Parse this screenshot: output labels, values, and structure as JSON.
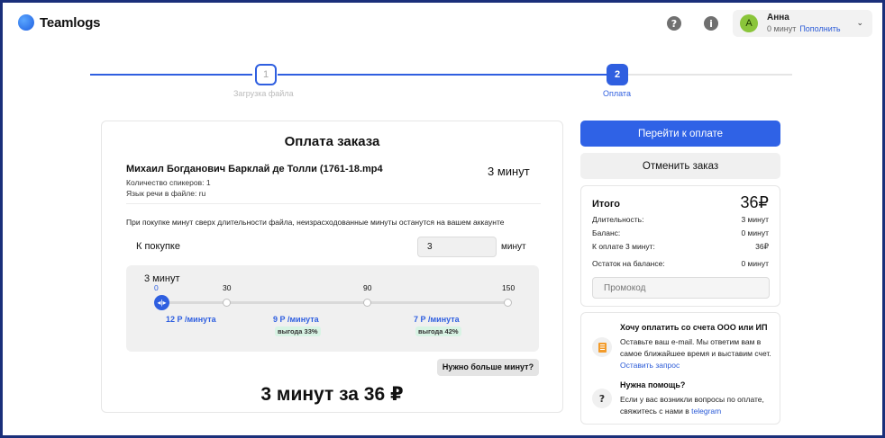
{
  "header": {
    "logo_text": "Teamlogs",
    "help_glyph": "?",
    "info_glyph": "i",
    "account": {
      "avatar_letter": "А",
      "name": "Анна",
      "balance": "0 минут",
      "topup_label": "Пополнить",
      "chevron": "⌄"
    }
  },
  "stepper": {
    "steps": [
      {
        "number": "1",
        "label": "Загрузка файла",
        "state": "done"
      },
      {
        "number": "2",
        "label": "Оплата",
        "state": "active"
      }
    ]
  },
  "order": {
    "title": "Оплата заказа",
    "file_name": "Михаил Богданович Барклай де Толли (1761-18.mp4",
    "file_duration": "3 минут",
    "speakers": "Количество спикеров: 1",
    "language": "Язык речи в файле: ru",
    "notice": "При покупке минут сверх длительности файла, неизрасходованные минуты останутся на вашем аккаунте",
    "buy_label": "К покупке",
    "buy_value": "3",
    "buy_unit": "минут",
    "slider": {
      "current_label": "3 минут",
      "ticks": [
        "0",
        "30",
        "90",
        "150"
      ],
      "thumb_glyph": "◂|▸",
      "prices": [
        "12 Р /минута",
        "9 Р /минута",
        "7 Р /минута"
      ],
      "badges": [
        "выгода 33%",
        "выгода 42%"
      ]
    },
    "more_minutes_label": "Нужно больше минут?",
    "total_text": "3 минут за 36 ₽"
  },
  "actions": {
    "pay_label": "Перейти к оплате",
    "cancel_label": "Отменить заказ"
  },
  "summary": {
    "title": "Итого",
    "total": "36₽",
    "rows": [
      {
        "label": "Длительность:",
        "value": "3 минут"
      },
      {
        "label": "Баланс:",
        "value": "0 минут"
      },
      {
        "label": "К оплате 3 минут:",
        "value": "36₽"
      },
      {
        "label": "Остаток на балансе:",
        "value": "0 минут"
      }
    ],
    "promo_placeholder": "Промокод"
  },
  "help": {
    "company_title": "Хочу оплатить со счета ООО или ИП",
    "company_text": "Оставьте ваш e-mail. Мы ответим вам в самое ближайшее время и выставим счет.",
    "company_link": "Оставить запрос",
    "support_title": "Нужна помощь?",
    "support_text": "Если у вас возникли вопросы по оплате, свяжитесь с нами в",
    "support_link": "telegram",
    "question_glyph": "?"
  },
  "colors": {
    "accent": "#2f62e6",
    "frame": "#1a2f7a",
    "avatar": "#8ac53a",
    "badge_bg": "#d8f3e4",
    "office_icon": "#f29b2b"
  }
}
